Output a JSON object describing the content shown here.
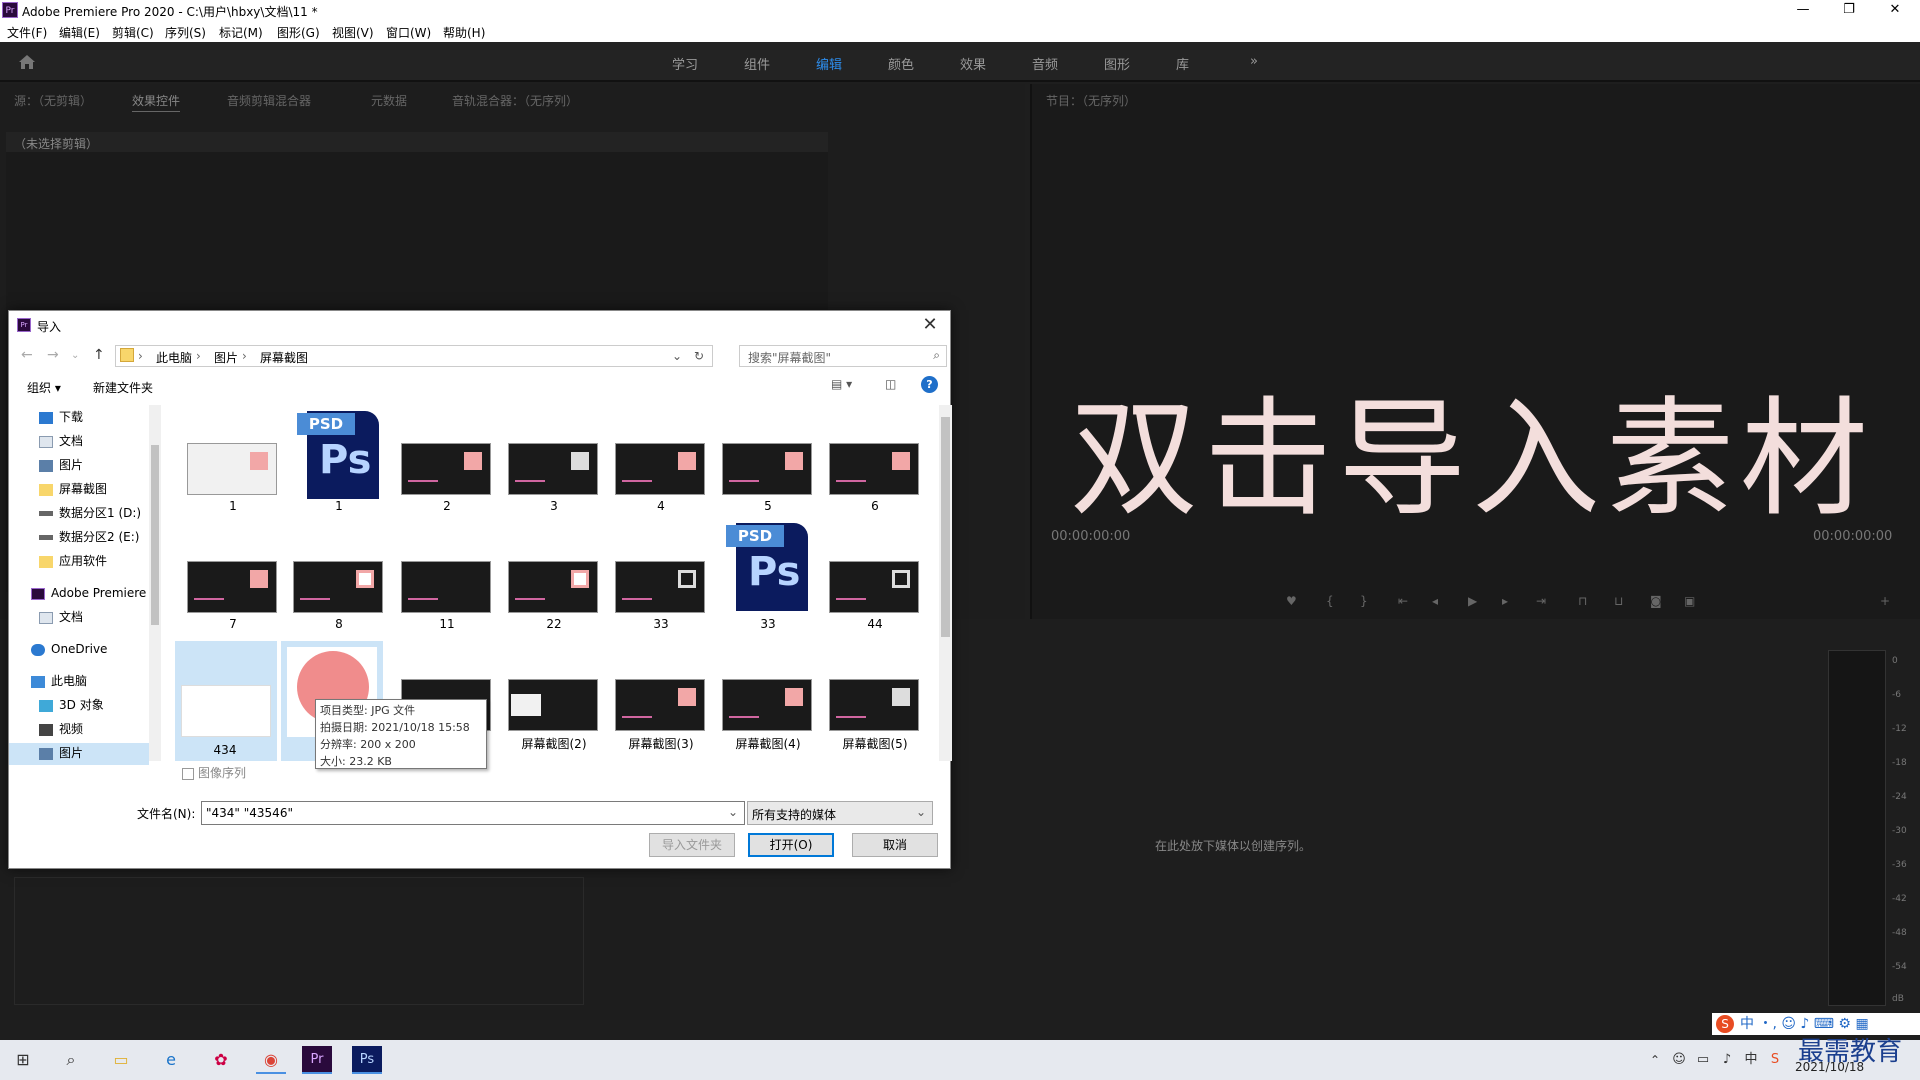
{
  "window": {
    "app_icon": "Pr",
    "title": "Adobe Premiere Pro 2020 - C:\\用户\\hbxy\\文档\\11 *",
    "controls": [
      "—",
      "❐",
      "✕"
    ]
  },
  "menu": [
    "文件(F)",
    "编辑(E)",
    "剪辑(C)",
    "序列(S)",
    "标记(M)",
    "图形(G)",
    "视图(V)",
    "窗口(W)",
    "帮助(H)"
  ],
  "workspaces": {
    "items": [
      "学习",
      "组件",
      "编辑",
      "颜色",
      "效果",
      "音频",
      "图形",
      "库"
    ],
    "active": "编辑",
    "more": "»"
  },
  "source_panel": {
    "tabs": [
      "源：（无剪辑）",
      "效果控件",
      "音频剪辑混合器",
      "元数据",
      "音轨混合器：（无序列）"
    ],
    "active_tab": "效果控件",
    "no_clip_text": "（未选择剪辑）"
  },
  "program_panel": {
    "tab": "节目：（无序列）",
    "overlay_text": "双击导入素材",
    "timecode_left": "00:00:00:00",
    "timecode_right": "00:00:00:00"
  },
  "timeline": {
    "empty_message": "在此处放下媒体以创建序列。"
  },
  "audio_meter": {
    "labels": [
      "0",
      "-6",
      "-12",
      "-18",
      "-24",
      "-30",
      "-36",
      "-42",
      "-48",
      "-54",
      "dB"
    ]
  },
  "dialog": {
    "title": "导入",
    "close": "✕",
    "breadcrumb": [
      "此电脑",
      "图片",
      "屏幕截图"
    ],
    "search_placeholder": "搜索\"屏幕截图\"",
    "toolbar": {
      "organize": "组织 ▾",
      "new_folder": "新建文件夹"
    },
    "sidebar": [
      {
        "label": "下载",
        "icon": "download-icon"
      },
      {
        "label": "文档",
        "icon": "document-icon"
      },
      {
        "label": "图片",
        "icon": "pictures-icon"
      },
      {
        "label": "屏幕截图",
        "icon": "folder-icon"
      },
      {
        "label": "数据分区1 (D:)",
        "icon": "drive-icon"
      },
      {
        "label": "数据分区2 (E:)",
        "icon": "drive-icon"
      },
      {
        "label": "应用软件",
        "icon": "folder-icon"
      },
      {
        "label": "Adobe Premiere",
        "icon": "premiere-icon"
      },
      {
        "label": "文档",
        "icon": "document-icon"
      },
      {
        "label": "OneDrive",
        "icon": "cloud-icon"
      },
      {
        "label": "此电脑",
        "icon": "computer-icon"
      },
      {
        "label": "3D 对象",
        "icon": "cube-icon"
      },
      {
        "label": "视频",
        "icon": "video-icon"
      },
      {
        "label": "图片",
        "icon": "pictures-icon"
      }
    ],
    "files": [
      {
        "name": "1",
        "kind": "thumb"
      },
      {
        "name": "1",
        "kind": "psd"
      },
      {
        "name": "2",
        "kind": "thumb"
      },
      {
        "name": "3",
        "kind": "thumb"
      },
      {
        "name": "4",
        "kind": "thumb"
      },
      {
        "name": "5",
        "kind": "thumb"
      },
      {
        "name": "6",
        "kind": "thumb"
      },
      {
        "name": "7",
        "kind": "thumb"
      },
      {
        "name": "8",
        "kind": "thumb"
      },
      {
        "name": "11",
        "kind": "thumb"
      },
      {
        "name": "22",
        "kind": "thumb"
      },
      {
        "name": "33",
        "kind": "thumb"
      },
      {
        "name": "33",
        "kind": "psd"
      },
      {
        "name": "44",
        "kind": "thumb"
      },
      {
        "name": "434",
        "kind": "white",
        "selected": true
      },
      {
        "name": "",
        "kind": "circle",
        "selected": true
      },
      {
        "name": "",
        "kind": "thumb"
      },
      {
        "name": "屏幕截图(2)",
        "kind": "thumb"
      },
      {
        "name": "屏幕截图(3)",
        "kind": "thumb"
      },
      {
        "name": "屏幕截图(4)",
        "kind": "thumb"
      },
      {
        "name": "屏幕截图(5)",
        "kind": "thumb"
      }
    ],
    "psd_badge": "PSD",
    "ps_text": "Ps",
    "tooltip": {
      "type": "项目类型: JPG 文件",
      "date": "拍摄日期: 2021/10/18 15:58",
      "resolution": "分辨率: 200 x 200",
      "size": "大小: 23.2 KB"
    },
    "image_sequence": "图像序列",
    "filename_label": "文件名(N):",
    "filename_value": "\"434\" \"43546\"",
    "filter": "所有支持的媒体",
    "buttons": {
      "import_folder": "导入文件夹",
      "open": "打开(O)",
      "cancel": "取消"
    }
  },
  "taskbar": {
    "date": "2021/10/18",
    "brand": "最需教育",
    "ime": "中 ・, ☺ ♪ ⌨ ⚙ ▦"
  }
}
